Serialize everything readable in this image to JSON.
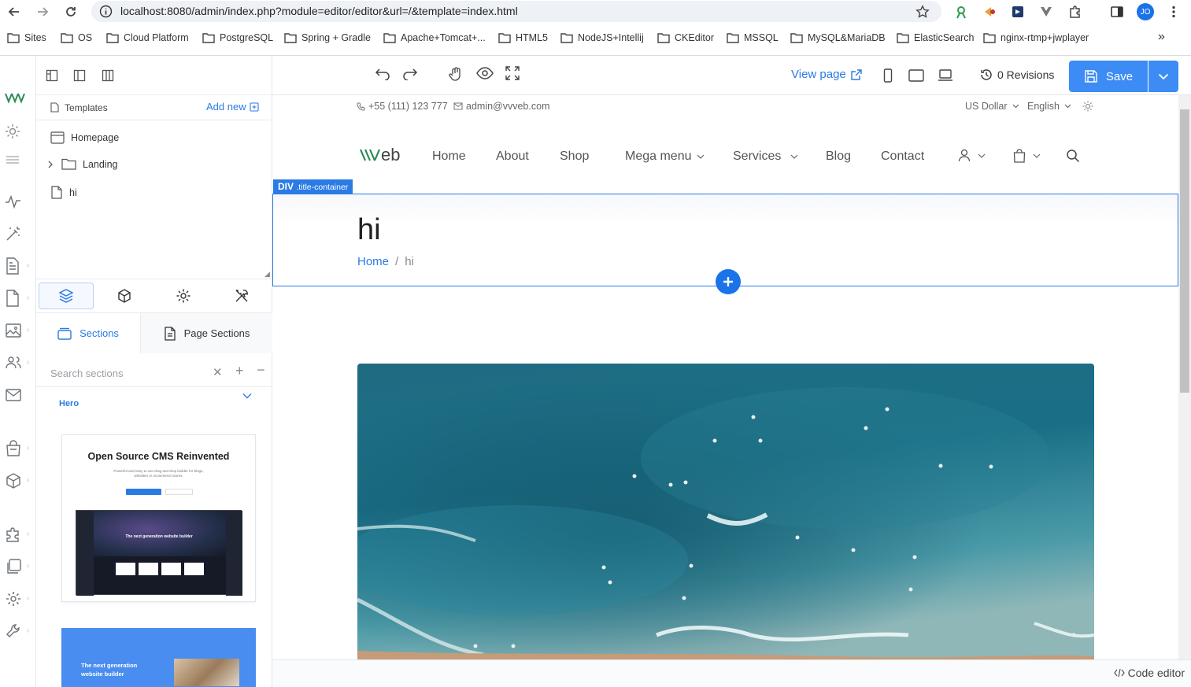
{
  "browser": {
    "url": "localhost:8080/admin/index.php?module=editor/editor&url=/&template=index.html",
    "profile_initials": "JO",
    "bookmarks": [
      "Sites",
      "OS",
      "Cloud Platform",
      "PostgreSQL",
      "Spring + Gradle",
      "Apache+Tomcat+...",
      "HTML5",
      "NodeJS+Intellij",
      "CKEditor",
      "MSSQL",
      "MySQL&MariaDB",
      "ElasticSearch",
      "nginx-rtmp+jwplayer"
    ],
    "more_bookmarks": "»"
  },
  "rail": {
    "icons": [
      "vvveb-logo-icon",
      "sun-icon",
      "menu-icon",
      "activity-icon",
      "magic-wand-icon",
      "document-icon",
      "file-icon",
      "image-icon",
      "users-icon",
      "mail-icon",
      "shopping-bag-icon",
      "cube-icon",
      "puzzle-icon",
      "copy-icon",
      "gear-icon",
      "wrench-icon"
    ]
  },
  "left_panel": {
    "templates_title": "Templates",
    "add_new": "Add new",
    "tree": [
      {
        "label": "Homepage",
        "type": "page"
      },
      {
        "label": "Landing",
        "type": "folder"
      },
      {
        "label": "hi",
        "type": "file"
      }
    ],
    "tab_sections": "Sections",
    "tab_page_sections": "Page Sections",
    "search_placeholder": "Search sections",
    "group_hero": "Hero",
    "thumb1_title": "Open Source CMS Reinvented",
    "thumb1_sub": "Powerful and easy to use drag and drop builder for blogs, websites or ecommerce stores.",
    "thumb1_inner": "The next generation website builder",
    "thumb2_title": "The next generation website builder"
  },
  "toolbar": {
    "view_page": "View page",
    "revisions": "0 Revisions",
    "save": "Save"
  },
  "site": {
    "phone": "+55 (111) 123 777",
    "email": "admin@vvveb.com",
    "currency": "US Dollar",
    "language": "English",
    "logo_text": "\\\\\\veb",
    "nav": {
      "home": "Home",
      "about": "About",
      "shop": "Shop",
      "mega_menu": "Mega menu",
      "services": "Services",
      "blog": "Blog",
      "contact": "Contact"
    },
    "selected_tag": "DIV",
    "selected_class": ".title-container",
    "page_title": "hi",
    "breadcrumb_home": "Home",
    "breadcrumb_sep": "/",
    "breadcrumb_current": "hi"
  },
  "bottom": {
    "code_editor": "Code editor"
  },
  "colors": {
    "accent": "#2b7be5",
    "save": "#3d8cf5",
    "logo_green": "#2e8b57"
  }
}
